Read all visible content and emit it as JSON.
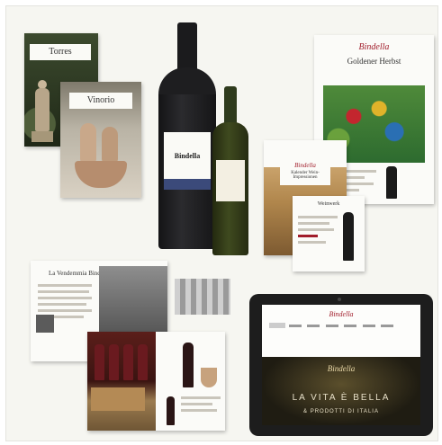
{
  "collage": {
    "torres_label": "Torres",
    "vinorio_label": "Vinorio",
    "bottle_big_label": "Bindella",
    "herbst_logo": "Bindella",
    "herbst_title": "Goldener Herbst",
    "kalender_logo": "Bindella",
    "kalender_inset": "Kalender Wein-Impressionen",
    "price_flyer_title": "Weinwerk",
    "magazine_title": "La Vendemmia Bindella",
    "tablet_logo": "Bindella",
    "tablet_hero_brand": "Bindella",
    "tablet_hero_tagline": "LA VITA È BELLA",
    "tablet_hero_sub": "& PRODOTTI DI ITALIA"
  }
}
